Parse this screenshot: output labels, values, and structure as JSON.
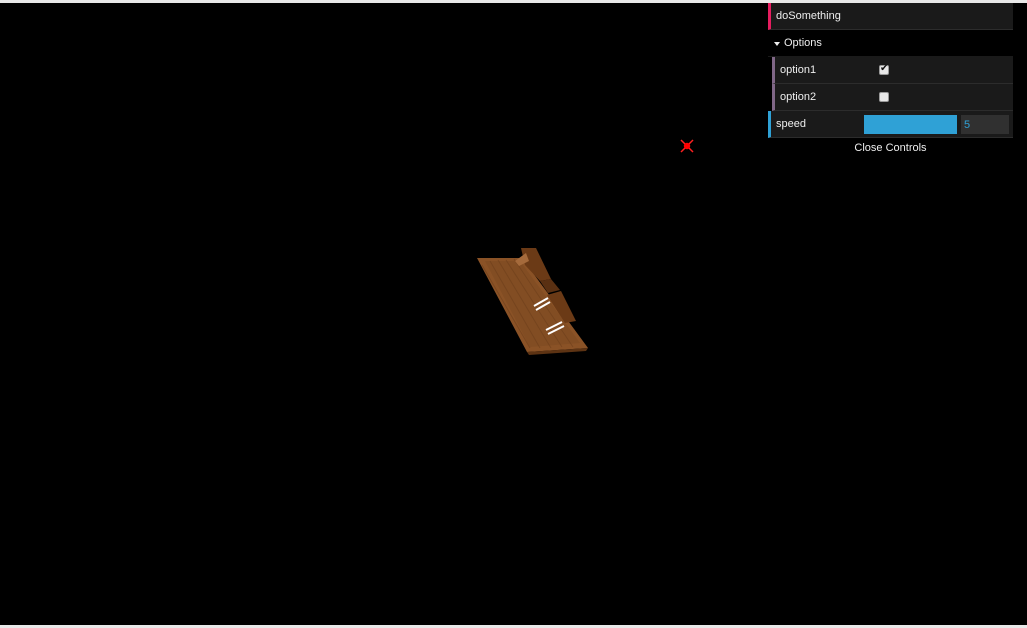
{
  "gui": {
    "function_label": "doSomething",
    "folder_label": "Options",
    "option1": {
      "label": "option1",
      "checked": true
    },
    "option2": {
      "label": "option2",
      "checked": false
    },
    "speed": {
      "label": "speed",
      "value": "5",
      "fill_fraction": 1.0
    },
    "close_label": "Close Controls"
  },
  "colors": {
    "scene_background": "#000000",
    "function_accent": "#e61d5f",
    "boolean_accent": "#806787",
    "number_accent": "#2fa1d6",
    "marker": "#ff0000",
    "model_wood": "#8a5226"
  },
  "icons": {
    "marker": "crosshair-marker-icon",
    "folder_toggle": "caret-down-icon",
    "checkbox_tick": "check-icon"
  }
}
